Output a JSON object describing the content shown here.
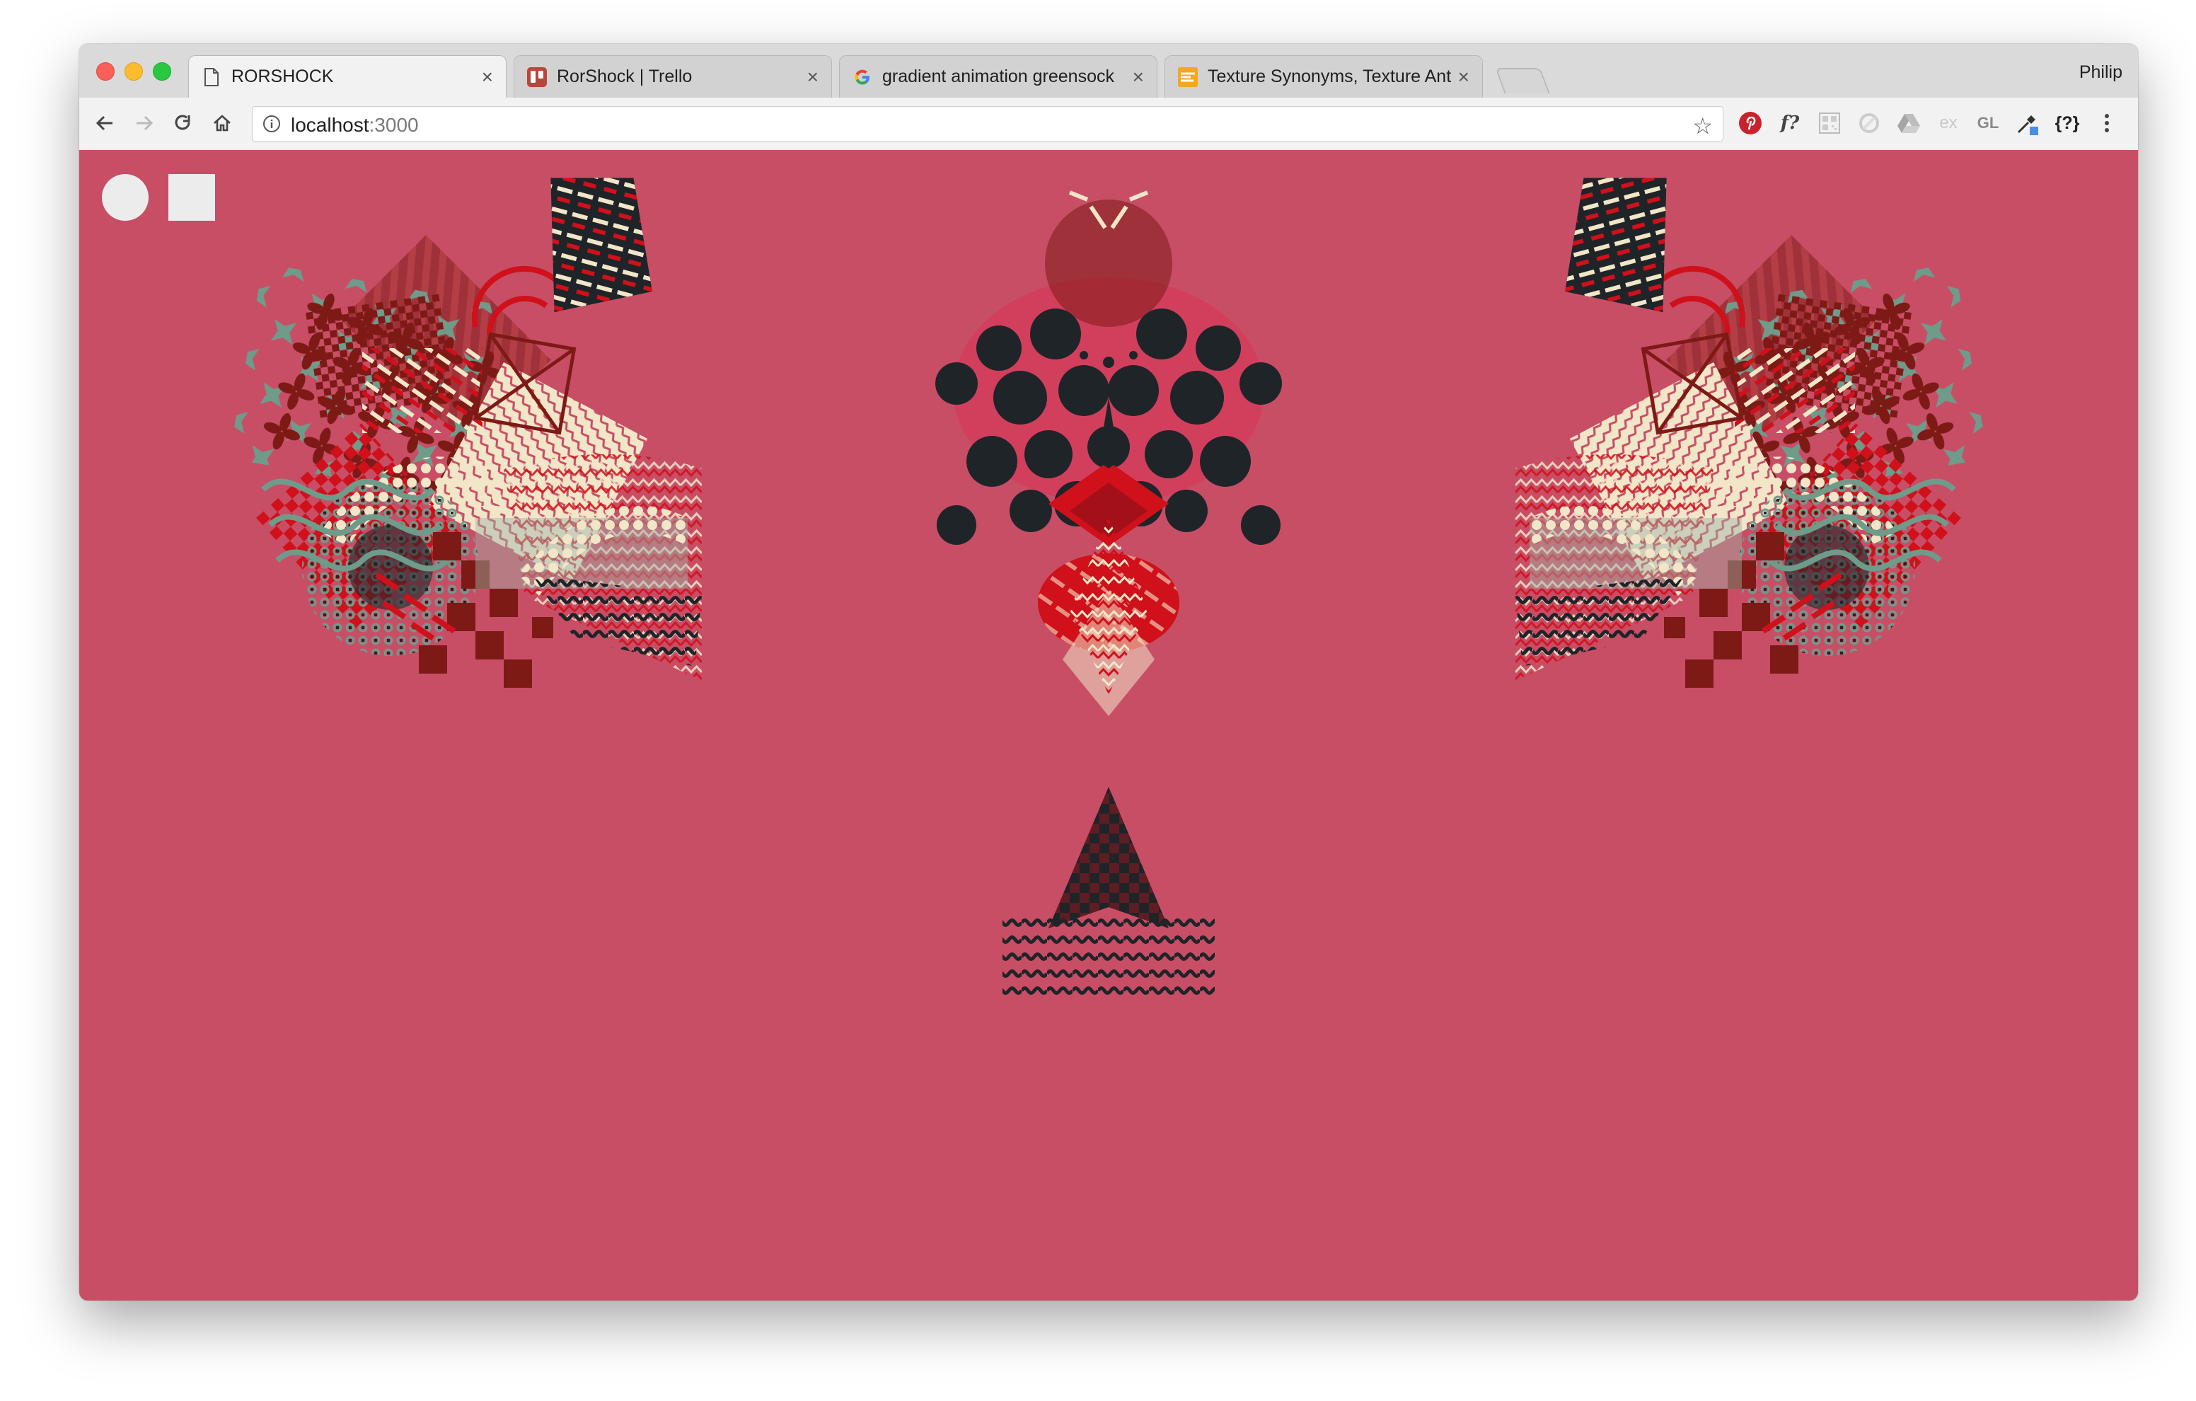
{
  "browser": {
    "profile_name": "Philip",
    "tabs": [
      {
        "title": "RORSHOCK",
        "icon": "document-icon",
        "active": true
      },
      {
        "title": "RorShock | Trello",
        "icon": "trello-icon",
        "active": false
      },
      {
        "title": "gradient animation greensock",
        "icon": "google-icon",
        "active": false
      },
      {
        "title": "Texture Synonyms, Texture Ant",
        "icon": "thesaurus-icon",
        "active": false
      }
    ],
    "tab_close_glyph": "×",
    "address": {
      "host": "localhost",
      "port": ":3000"
    },
    "extensions": [
      "pinterest-icon",
      "whatfont-icon",
      "qr-icon",
      "ext-icon",
      "drive-icon",
      "ex-icon",
      "gl-icon",
      "eyedropper-icon",
      "json-icon",
      "menu-icon"
    ],
    "extension_labels": {
      "whatfont": "f?",
      "ex": "ex",
      "gl": "GL",
      "json": "{?}"
    }
  },
  "page": {
    "background": "#c84e66",
    "controls": [
      {
        "shape": "circle",
        "color": "#ececec"
      },
      {
        "shape": "square",
        "color": "#ececec"
      }
    ],
    "artwork_palette": {
      "dark_red": "#7d1a16",
      "red": "#d0101a",
      "charcoal": "#1f2428",
      "cream": "#f1e6c8",
      "teal": "#6f9b8a",
      "rose": "#c1495f"
    }
  }
}
